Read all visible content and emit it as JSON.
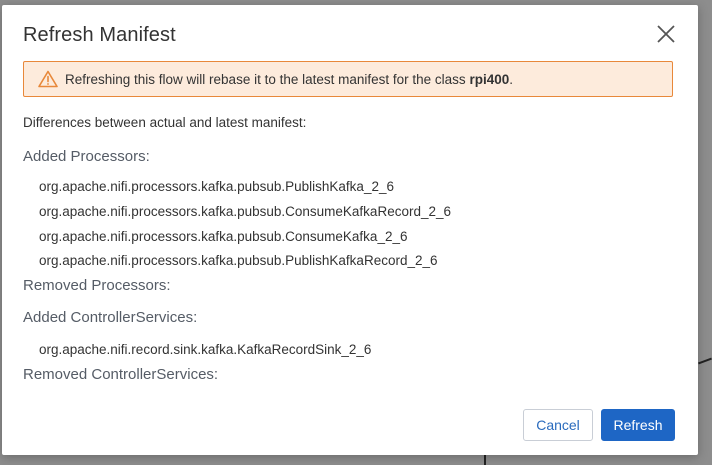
{
  "dialog": {
    "title": "Refresh Manifest",
    "close_icon": "close-icon",
    "warning": {
      "icon": "warning-triangle-icon",
      "text_before": "Refreshing this flow will rebase it to the latest manifest for the class ",
      "class_name": "rpi400",
      "text_after": ".",
      "accent_color": "#e8883a",
      "background_color": "#fdebdc"
    },
    "intro": "Differences between actual and latest manifest:",
    "sections": {
      "added_processors": {
        "heading": "Added Processors:",
        "items": [
          "org.apache.nifi.processors.kafka.pubsub.PublishKafka_2_6",
          "org.apache.nifi.processors.kafka.pubsub.ConsumeKafkaRecord_2_6",
          "org.apache.nifi.processors.kafka.pubsub.ConsumeKafka_2_6",
          "org.apache.nifi.processors.kafka.pubsub.PublishKafkaRecord_2_6"
        ]
      },
      "removed_processors": {
        "heading": "Removed Processors:",
        "items": []
      },
      "added_controller_services": {
        "heading": "Added ControllerServices:",
        "items": [
          "org.apache.nifi.record.sink.kafka.KafkaRecordSink_2_6"
        ]
      },
      "removed_controller_services": {
        "heading": "Removed ControllerServices:",
        "items": []
      }
    },
    "buttons": {
      "cancel_label": "Cancel",
      "refresh_label": "Refresh",
      "primary_color": "#1e66c5"
    }
  }
}
